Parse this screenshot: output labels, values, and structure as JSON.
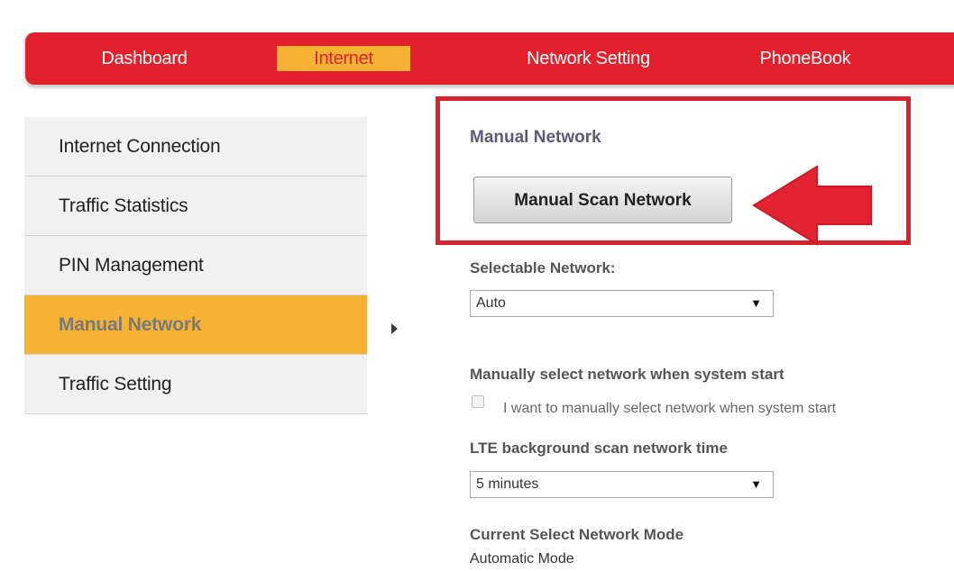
{
  "nav": {
    "items": [
      {
        "label": "Dashboard"
      },
      {
        "label": "Internet"
      },
      {
        "label": "Network Setting"
      },
      {
        "label": "PhoneBook"
      }
    ],
    "active": "Internet"
  },
  "sidebar": {
    "items": [
      {
        "label": "Internet Connection"
      },
      {
        "label": "Traffic Statistics"
      },
      {
        "label": "PIN Management"
      },
      {
        "label": "Manual Network"
      },
      {
        "label": "Traffic Setting"
      }
    ],
    "active": "Manual Network"
  },
  "main": {
    "title": "Manual Network",
    "scan_button": "Manual Scan Network",
    "selectable_label": "Selectable Network:",
    "selectable_value": "Auto",
    "manual_select_label": "Manually select network when system start",
    "manual_select_checkbox_label": "I want to manually select network when system start",
    "manual_select_checked": false,
    "lte_label": "LTE background scan network time",
    "lte_value": "5 minutes",
    "current_mode_label": "Current Select Network Mode",
    "current_mode_value": "Automatic Mode"
  },
  "colors": {
    "nav_bg": "#e3212d",
    "active_bg": "#f6b233",
    "highlight": "#d8222c"
  },
  "icons": {
    "caret": "▼",
    "annotation_arrow": "left-arrow"
  }
}
